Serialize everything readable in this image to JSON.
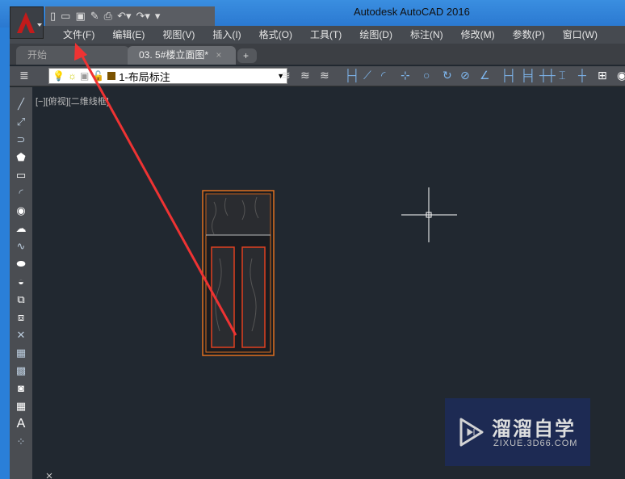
{
  "window": {
    "title": "Autodesk AutoCAD 2016"
  },
  "menu": [
    "文件(F)",
    "编辑(E)",
    "视图(V)",
    "插入(I)",
    "格式(O)",
    "工具(T)",
    "绘图(D)",
    "标注(N)",
    "修改(M)",
    "参数(P)",
    "窗口(W)"
  ],
  "tabs": [
    {
      "label": "开始"
    },
    {
      "label": "03. 5#楼立面图*",
      "close": "×"
    },
    {
      "label": "+"
    }
  ],
  "layer": {
    "name": "1-布局标注"
  },
  "viewport": {
    "label": "[−][俯视][二维线框]"
  },
  "watermark": {
    "name": "溜溜自学",
    "url": "ZIXUE.3D66.COM"
  },
  "colors": {
    "canvas": "#212830",
    "annotation": "#ee3333",
    "door": "#e07020"
  }
}
